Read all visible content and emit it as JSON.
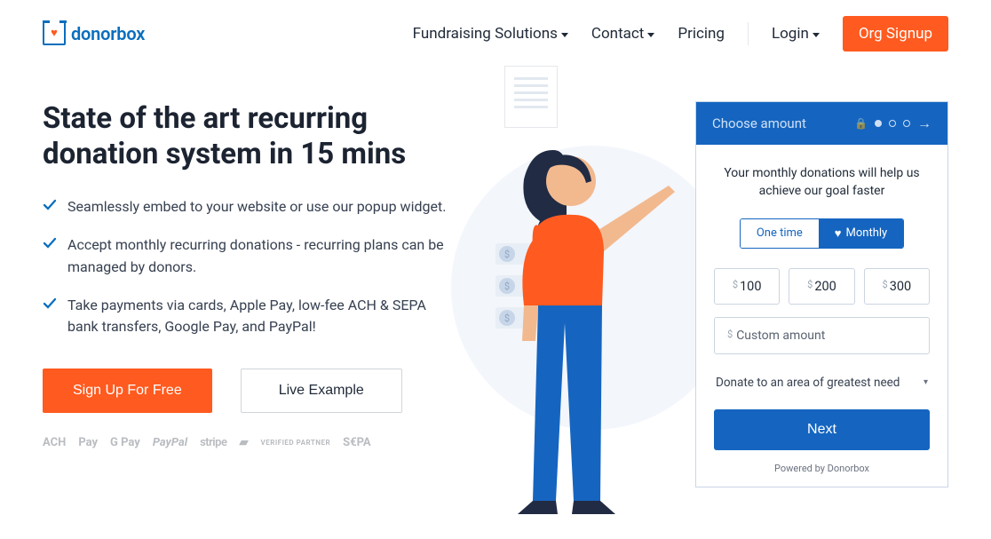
{
  "logo": {
    "text": "donorbox"
  },
  "nav": {
    "fundraising": "Fundraising Solutions",
    "contact": "Contact",
    "pricing": "Pricing",
    "login": "Login",
    "signup": "Org Signup"
  },
  "hero": {
    "headline": "State of the art recurring donation system in 15 mins",
    "features": [
      "Seamlessly embed to your website or use our popup widget.",
      "Accept monthly recurring donations - recurring plans can be managed by donors.",
      "Take payments via cards, Apple Pay, low-fee ACH & SEPA bank transfers, Google Pay, and PayPal!"
    ],
    "cta_signup": "Sign Up For Free",
    "cta_example": "Live Example",
    "paylogos": {
      "ach": "ACH",
      "applepay": "Pay",
      "gpay": "G Pay",
      "paypal": "PayPal",
      "stripe": "stripe",
      "verified": "VERIFIED PARTNER",
      "sepa": "S€PA"
    }
  },
  "widget": {
    "header": "Choose amount",
    "message": "Your monthly donations will help us achieve our goal faster",
    "tab_onetime": "One time",
    "tab_monthly": "Monthly",
    "amounts": [
      "100",
      "200",
      "300"
    ],
    "custom": "Custom amount",
    "designation": "Donate to an area of greatest need",
    "next": "Next",
    "powered": "Powered by Donorbox"
  }
}
